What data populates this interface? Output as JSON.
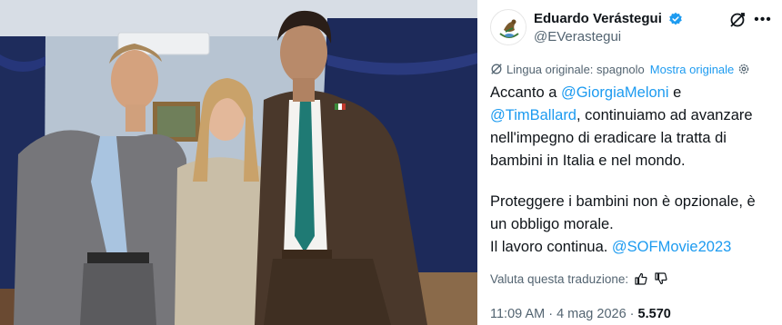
{
  "tweet": {
    "author": {
      "display_name": "Eduardo Verástegui",
      "handle": "@EVerastegui",
      "verified": true,
      "avatar_icon": "mexican-coat-of-arms-icon"
    },
    "translation_bar": {
      "label": "Lingua originale: spagnolo",
      "show_original": "Mostra originale"
    },
    "body": {
      "line1_pre": "Accanto a ",
      "mention1": "@GiorgiaMeloni",
      "line1_post": " e",
      "mention2": "@TimBallard",
      "line2_post": ", continuiamo ad avanzare nell'impegno di eradicare la tratta di bambini in Italia e nel mondo.",
      "para2": "Proteggere i bambini non è opzionale, è un obbligo morale.",
      "para3_pre": "Il lavoro continua. ",
      "mention3": "@SOFMovie2023"
    },
    "rate_translation": "Valuta questa traduzione:",
    "timestamp": "11:09 AM · 4 mag 2026 · ",
    "views": "5.570",
    "colors": {
      "link": "#1d9bf0",
      "text": "#0f1419",
      "secondary": "#536471"
    }
  },
  "photo": {
    "subject": "three people posing together"
  }
}
